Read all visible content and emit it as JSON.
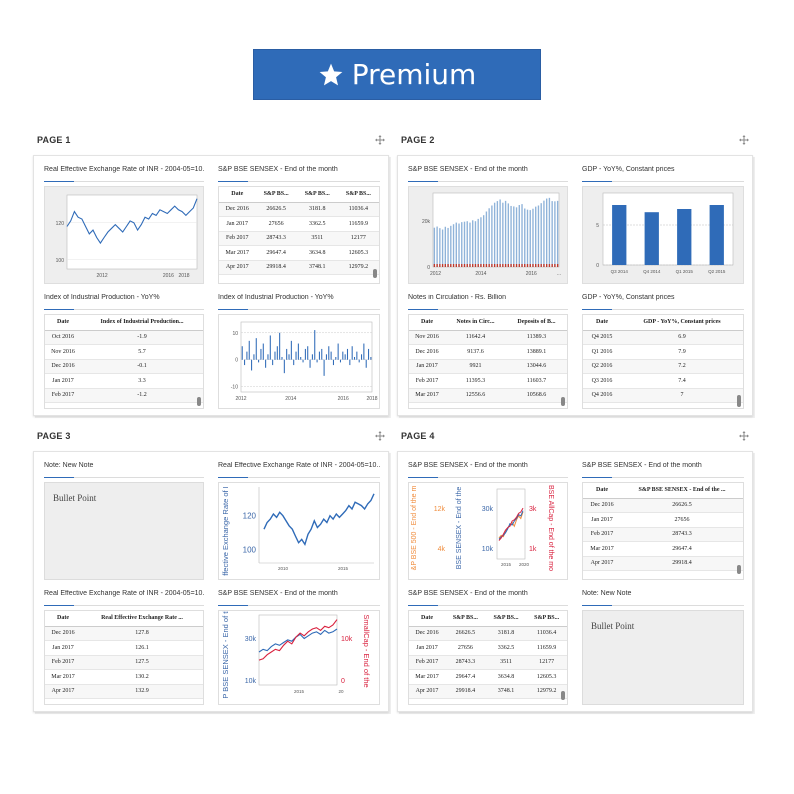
{
  "premium": {
    "label": "Premium",
    "icon": "star-icon"
  },
  "pages": [
    {
      "title": "PAGE 1"
    },
    {
      "title": "PAGE 2"
    },
    {
      "title": "PAGE 3"
    },
    {
      "title": "PAGE 4"
    }
  ],
  "p1": {
    "reer_chart_title": "Real Effective Exchange Rate of INR - 2004-05=10...",
    "sensex_table_title": "S&P BSE SENSEX - End of the month",
    "iip_table_title": "Index of Industrial Production - YoY%",
    "iip_chart_title": "Index of Industrial Production - YoY%"
  },
  "p2": {
    "sensex_chart_title": "S&P BSE SENSEX - End of the month",
    "gdp_chart_title": "GDP - YoY%, Constant prices",
    "notes_table_title": "Notes in Circulation - Rs. Billion",
    "gdp_table_title": "GDP - YoY%, Constant prices"
  },
  "p3": {
    "note_title": "Note: New Note",
    "note_text": "Bullet Point",
    "reer_chart_title": "Real Effective Exchange Rate of INR - 2004-05=10...",
    "reer_table_title": "Real Effective Exchange Rate of INR - 2004-05=10...",
    "sensex_dual_title": "S&P BSE SENSEX - End of the month"
  },
  "p4": {
    "sensex_multi_title": "S&P BSE SENSEX - End of the month",
    "sensex_table_title": "S&P BSE SENSEX - End of the month",
    "sensex_table2_title": "S&P BSE SENSEX - End of the month",
    "note_title": "Note: New Note",
    "note_text": "Bullet Point"
  },
  "tables": {
    "sensex3": {
      "headers": [
        "Date",
        "S&P BS...",
        "S&P BS...",
        "S&P BS..."
      ],
      "rows": [
        [
          "Dec 2016",
          "26626.5",
          "3181.8",
          "11036.4"
        ],
        [
          "Jan 2017",
          "27656",
          "3362.5",
          "11659.9"
        ],
        [
          "Feb 2017",
          "28743.3",
          "3511",
          "12177"
        ],
        [
          "Mar 2017",
          "29647.4",
          "3634.8",
          "12605.3"
        ],
        [
          "Apr 2017",
          "29918.4",
          "3748.1",
          "12979.2"
        ]
      ]
    },
    "sensex3_p4": {
      "headers": [
        "Date",
        "S&P BS...",
        "S&P BS...",
        "S&P BS..."
      ],
      "rows": [
        [
          "Dec 2016",
          "26626.5",
          "3181.8",
          "11036.4"
        ],
        [
          "Jan 2017",
          "27656",
          "3362.5",
          "11659.9"
        ],
        [
          "Feb 2017",
          "28743.3",
          "3511",
          "12177"
        ],
        [
          "Mar 2017",
          "29647.4",
          "3634.8",
          "12605.3"
        ],
        [
          "Apr 2017",
          "29918.4",
          "3748.1",
          "12979.2"
        ]
      ]
    },
    "iip": {
      "headers": [
        "Date",
        "Index of Industrial Production..."
      ],
      "rows": [
        [
          "Oct 2016",
          "-1.9"
        ],
        [
          "Nov 2016",
          "5.7"
        ],
        [
          "Dec 2016",
          "-0.1"
        ],
        [
          "Jan 2017",
          "3.3"
        ],
        [
          "Feb 2017",
          "-1.2"
        ]
      ]
    },
    "notes": {
      "headers": [
        "Date",
        "Notes in Circ...",
        "Deposits of B..."
      ],
      "rows": [
        [
          "Nov 2016",
          "11642.4",
          "11389.3"
        ],
        [
          "Dec 2016",
          "9137.6",
          "13889.1"
        ],
        [
          "Jan 2017",
          "9921",
          "13044.6"
        ],
        [
          "Feb 2017",
          "11395.3",
          "11603.7"
        ],
        [
          "Mar 2017",
          "12556.6",
          "10568.6"
        ]
      ]
    },
    "gdp": {
      "headers": [
        "Date",
        "GDP - YoY%, Constant prices"
      ],
      "rows": [
        [
          "Q4 2015",
          "6.9"
        ],
        [
          "Q1 2016",
          "7.9"
        ],
        [
          "Q2 2016",
          "7.2"
        ],
        [
          "Q3 2016",
          "7.4"
        ],
        [
          "Q4 2016",
          "7"
        ]
      ]
    },
    "reer": {
      "headers": [
        "Date",
        "Real Effective Exchange Rate ..."
      ],
      "rows": [
        [
          "Dec 2016",
          "127.8"
        ],
        [
          "Jan 2017",
          "126.1"
        ],
        [
          "Feb 2017",
          "127.5"
        ],
        [
          "Mar 2017",
          "130.2"
        ],
        [
          "Apr 2017",
          "132.9"
        ]
      ]
    },
    "sensex1": {
      "headers": [
        "Date",
        "S&P BSE SENSEX - End of the ..."
      ],
      "rows": [
        [
          "Dec 2016",
          "26626.5"
        ],
        [
          "Jan 2017",
          "27656"
        ],
        [
          "Feb 2017",
          "28743.3"
        ],
        [
          "Mar 2017",
          "29647.4"
        ],
        [
          "Apr 2017",
          "29918.4"
        ]
      ]
    }
  },
  "chart_data": [
    {
      "type": "line",
      "id": "reer_small",
      "x_ticks": [
        "2012",
        "2016",
        "2018"
      ],
      "y_ticks": [
        "100",
        "120"
      ],
      "ylim": [
        95,
        135
      ],
      "series": [
        {
          "values": [
            118,
            121,
            126,
            123,
            122,
            118,
            114,
            116,
            112,
            109,
            112,
            115,
            117,
            119,
            117,
            115,
            118,
            121,
            120,
            116,
            119,
            123,
            122,
            125,
            124,
            127,
            126,
            125,
            127,
            129,
            127,
            126,
            124,
            126,
            128,
            133
          ]
        }
      ],
      "color": "#2f6bb8"
    },
    {
      "type": "bar",
      "id": "iip_bar",
      "x_ticks": [
        "2012",
        "2014",
        "2016",
        "2018"
      ],
      "y_ticks": [
        "10",
        "0",
        "-10"
      ],
      "ylim": [
        -12,
        14
      ],
      "series": [
        {
          "values": [
            5,
            -2,
            3,
            7,
            -4,
            2,
            8,
            -1,
            4,
            6,
            -3,
            2,
            9,
            -2,
            3,
            5,
            10,
            1,
            -5,
            4,
            2,
            7,
            -2,
            3,
            6,
            1,
            -1,
            4,
            5,
            -3,
            2,
            11,
            -1,
            3,
            4,
            -6,
            2,
            5,
            3,
            -2,
            1,
            6,
            -1,
            3,
            2,
            4,
            -2,
            5,
            1,
            3,
            -1,
            2,
            6,
            -3,
            4,
            1
          ]
        }
      ],
      "color": "#2f6bb8"
    },
    {
      "type": "bar",
      "id": "sensex_bar",
      "x_ticks": [
        "2012",
        "2014",
        "2016",
        "..."
      ],
      "y_ticks": [
        "20k",
        "0"
      ],
      "ylim": [
        0,
        32000
      ],
      "series": [
        {
          "name": "S&P BSE SENSEX",
          "values": [
            17000,
            17500,
            16800,
            16200,
            17400,
            16900,
            17800,
            18500,
            19200,
            18800,
            19400,
            19600,
            19800,
            19200,
            20200,
            19800,
            20800,
            21500,
            22400,
            24000,
            25400,
            26600,
            27800,
            28500,
            29200,
            27800,
            28600,
            27500,
            26400,
            26200,
            25800,
            26800,
            27200,
            25300,
            24800,
            24600,
            25200,
            26100,
            26600,
            27600,
            28700,
            29600,
            29900,
            28500,
            28400,
            28600
          ]
        }
      ],
      "colors": [
        "#8fb3d9",
        "#c0392b"
      ]
    },
    {
      "type": "bar",
      "id": "gdp_bar",
      "categories": [
        "Q3 2014",
        "Q4 2014",
        "Q1 2015",
        "Q2 2015"
      ],
      "values": [
        7.5,
        6.6,
        7.0,
        7.5
      ],
      "y_ticks": [
        "5",
        "0"
      ],
      "ylim": [
        0,
        9
      ],
      "color": "#2f6bb8"
    },
    {
      "type": "line",
      "id": "reer_large",
      "x_ticks": [
        "2010",
        "2015"
      ],
      "y_ticks": [
        "100",
        "120"
      ],
      "ylim": [
        92,
        137
      ],
      "ylabel": "ffective Exchange Rate of I",
      "series": [
        {
          "values": [
            112,
            116,
            118,
            121,
            119,
            122,
            120,
            117,
            114,
            112,
            108,
            104,
            106,
            103,
            109,
            112,
            117,
            113,
            115,
            118,
            116,
            120,
            118,
            121,
            119,
            121,
            123,
            126,
            124,
            128,
            127,
            126,
            124,
            127,
            129,
            133
          ]
        }
      ],
      "color": "#2f6bb8"
    },
    {
      "type": "line",
      "id": "sensex_dual",
      "x_ticks": [
        "2015",
        "20"
      ],
      "y_ticks_left": [
        "30k",
        "10k"
      ],
      "y_ticks_right": [
        "10k",
        "0"
      ],
      "ylabel_left": "P BSE SENSEX - End of the",
      "ylabel_right": "SmallCap - End of the",
      "series": [
        {
          "values": [
            20,
            22,
            21,
            24,
            26,
            25,
            27,
            29,
            28,
            31,
            33,
            30,
            32,
            34,
            35,
            33,
            36,
            34,
            35,
            37
          ],
          "color": "#2f6bb8"
        },
        {
          "values": [
            14,
            15,
            18,
            20,
            22,
            21,
            25,
            28,
            26,
            31,
            34,
            32,
            35,
            37,
            38,
            36,
            39,
            38,
            40,
            44
          ],
          "color": "#d9213e"
        }
      ]
    },
    {
      "type": "line",
      "id": "sensex_multi",
      "x_ticks": [
        "2015",
        "2020"
      ],
      "y_ticks_left": [
        "12k",
        "4k"
      ],
      "y_ticks_left2": [
        "30k",
        "10k"
      ],
      "y_ticks_right": [
        "3k",
        "1k"
      ],
      "ylabel_left": "&P BSE 500 - End of the m",
      "ylabel_left2": "BSE SENSEX - End of the",
      "ylabel_right": "BSE AllCap - End of the mo",
      "series": [
        {
          "values": [
            10,
            12,
            11,
            15,
            18,
            20,
            22,
            19,
            24,
            27,
            25,
            30
          ],
          "color": "#f08c3c"
        },
        {
          "values": [
            9,
            11,
            12,
            14,
            17,
            21,
            20,
            23,
            25,
            28,
            27,
            31
          ],
          "color": "#2f6bb8"
        },
        {
          "values": [
            8,
            10,
            13,
            16,
            18,
            19,
            23,
            24,
            26,
            29,
            30,
            33
          ],
          "color": "#d9213e"
        }
      ]
    }
  ]
}
